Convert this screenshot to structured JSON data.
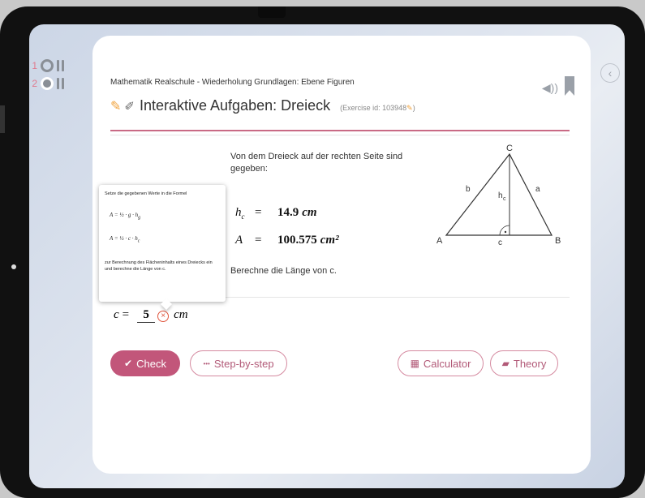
{
  "rail": {
    "items": [
      {
        "num": "1",
        "type": "circle"
      },
      {
        "num": "2",
        "type": "circle-c"
      }
    ]
  },
  "header": {
    "breadcrumb": "Mathematik Realschule - Wiederholung Grundlagen: Ebene Figuren",
    "title": "Interaktive Aufgaben: Dreieck",
    "exercise_id": "(Exercise id: 103948",
    "exercise_id_close": ")"
  },
  "problem": {
    "text": "Von dem Dreieck auf der rechten Seite sind gegeben:",
    "given": [
      {
        "var": "h",
        "sub": "c",
        "eq": "=",
        "value": "14.9",
        "unit": "cm"
      },
      {
        "var": "A",
        "sub": "",
        "eq": "=",
        "value": "100.575",
        "unit": "cm²"
      }
    ],
    "question": "Berechne die Länge von c."
  },
  "triangle": {
    "labels": {
      "C": "C",
      "A": "A",
      "B": "B",
      "a": "a",
      "b": "b",
      "c": "c",
      "hc": "h",
      "hc_sub": "c"
    }
  },
  "hint": {
    "intro": "Setze die gegebenen Werte in die Formel",
    "formula1": "A  =  ½ · g · h",
    "formula1_sub": "g",
    "formula2": "A  =  ½ · c · h",
    "formula2_sub": "c",
    "outro": "zur Berechnung des Flächeninhalts eines Dreiecks ein und berechne die Länge von c."
  },
  "answer": {
    "var": "c",
    "eq": "=",
    "value": "5",
    "error_mark": "×",
    "unit": "cm"
  },
  "buttons": {
    "check": "Check",
    "step": "Step-by-step",
    "calculator": "Calculator",
    "theory": "Theory"
  },
  "icons": {
    "check_icon": "✔",
    "step_icon": "•••",
    "calculator_icon": "▦",
    "theory_icon": "▰",
    "speaker_icon": "◀))"
  },
  "colors": {
    "accent": "#c2567a",
    "error": "#e0553d",
    "pencil": "#f0a13a"
  }
}
